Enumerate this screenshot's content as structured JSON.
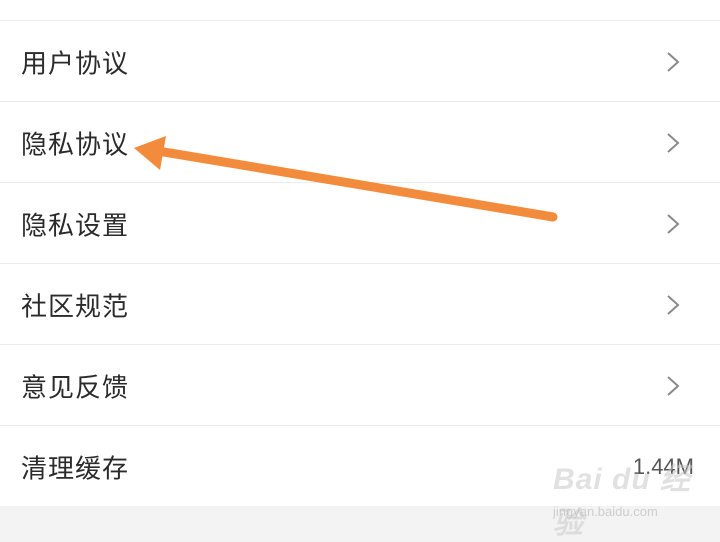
{
  "settings_list": {
    "items": [
      {
        "label": "用户协议",
        "chevron": "chevron-right-icon"
      },
      {
        "label": "隐私协议",
        "chevron": "chevron-right-icon"
      },
      {
        "label": "隐私设置",
        "chevron": "chevron-right-icon"
      },
      {
        "label": "社区规范",
        "chevron": "chevron-right-icon"
      },
      {
        "label": "意见反馈",
        "chevron": "chevron-right-icon"
      },
      {
        "label": "清理缓存",
        "value": "1.44M"
      }
    ]
  },
  "annotation": {
    "color": "#f28b3c",
    "points_to": "隐私协议"
  },
  "watermark": {
    "logo": "Bai du 经验",
    "url": "jingyan.baidu.com"
  }
}
